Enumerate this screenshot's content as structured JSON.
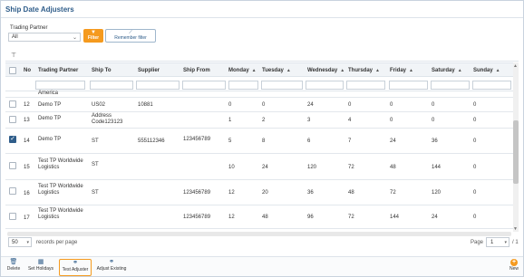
{
  "app": {
    "title": "Ship Date Adjusters"
  },
  "filters": {
    "trading_partner_label": "Trading Partner",
    "trading_partner_value": "All",
    "filter_button": "Filter",
    "remember_button": "Remember filter"
  },
  "grid": {
    "columns": [
      "No",
      "Trading Partner",
      "Ship To",
      "Supplier",
      "Ship From",
      "Monday",
      "Tuesday",
      "Wednesday",
      "Thursday",
      "Friday",
      "Saturday",
      "Sunday"
    ],
    "partial_row_text": "America",
    "rows": [
      {
        "no": "12",
        "trading_partner": "Demo TP",
        "ship_to": "US02",
        "supplier": "10881",
        "ship_from": "",
        "mon": "0",
        "tue": "0",
        "wed": "24",
        "thu": "0",
        "fri": "0",
        "sat": "0",
        "sun": "0",
        "checked": false
      },
      {
        "no": "13",
        "trading_partner": "Demo TP",
        "ship_to": "Address Code123123",
        "supplier": "",
        "ship_from": "",
        "mon": "1",
        "tue": "2",
        "wed": "3",
        "thu": "4",
        "fri": "0",
        "sat": "0",
        "sun": "0",
        "checked": false
      },
      {
        "no": "14",
        "trading_partner": "Demo TP",
        "ship_to": "ST",
        "supplier": "555112346",
        "ship_from": "123456789",
        "mon": "5",
        "tue": "8",
        "wed": "6",
        "thu": "7",
        "fri": "24",
        "sat": "36",
        "sun": "0",
        "checked": true
      },
      {
        "no": "15",
        "trading_partner": "Test TP Worldwide Logistics",
        "ship_to": "ST",
        "supplier": "",
        "ship_from": "",
        "mon": "10",
        "tue": "24",
        "wed": "120",
        "thu": "72",
        "fri": "48",
        "sat": "144",
        "sun": "0",
        "checked": false
      },
      {
        "no": "16",
        "trading_partner": "Test TP Worldwide Logistics",
        "ship_to": "ST",
        "supplier": "",
        "ship_from": "123456789",
        "mon": "12",
        "tue": "20",
        "wed": "36",
        "thu": "48",
        "fri": "72",
        "sat": "120",
        "sun": "0",
        "checked": false
      },
      {
        "no": "17",
        "trading_partner": "Test TP Worldwide Logistics",
        "ship_to": "",
        "supplier": "",
        "ship_from": "123456789",
        "mon": "12",
        "tue": "48",
        "wed": "96",
        "thu": "72",
        "fri": "144",
        "sat": "24",
        "sun": "0",
        "checked": false
      }
    ]
  },
  "pager": {
    "page_size": "50",
    "page_size_suffix": "records per page",
    "page_label": "Page",
    "current_page": "1",
    "total": "/ 1"
  },
  "toolbar": {
    "delete": "Delete",
    "set_holidays": "Set Holidays",
    "test_adjuster": "Test Adjuster",
    "adjust_existing": "Adjust Existing",
    "new": "New"
  },
  "icons": {
    "funnel": "funnel-icon",
    "delete": "trash-icon",
    "holidays": "calendar-icon",
    "test": "link-icon",
    "adjust": "link-icon",
    "new": "plus-circle-icon"
  },
  "colors": {
    "accent": "#f59a1e",
    "brand": "#2f5d8a",
    "checkbox": "#2f5d8a"
  }
}
